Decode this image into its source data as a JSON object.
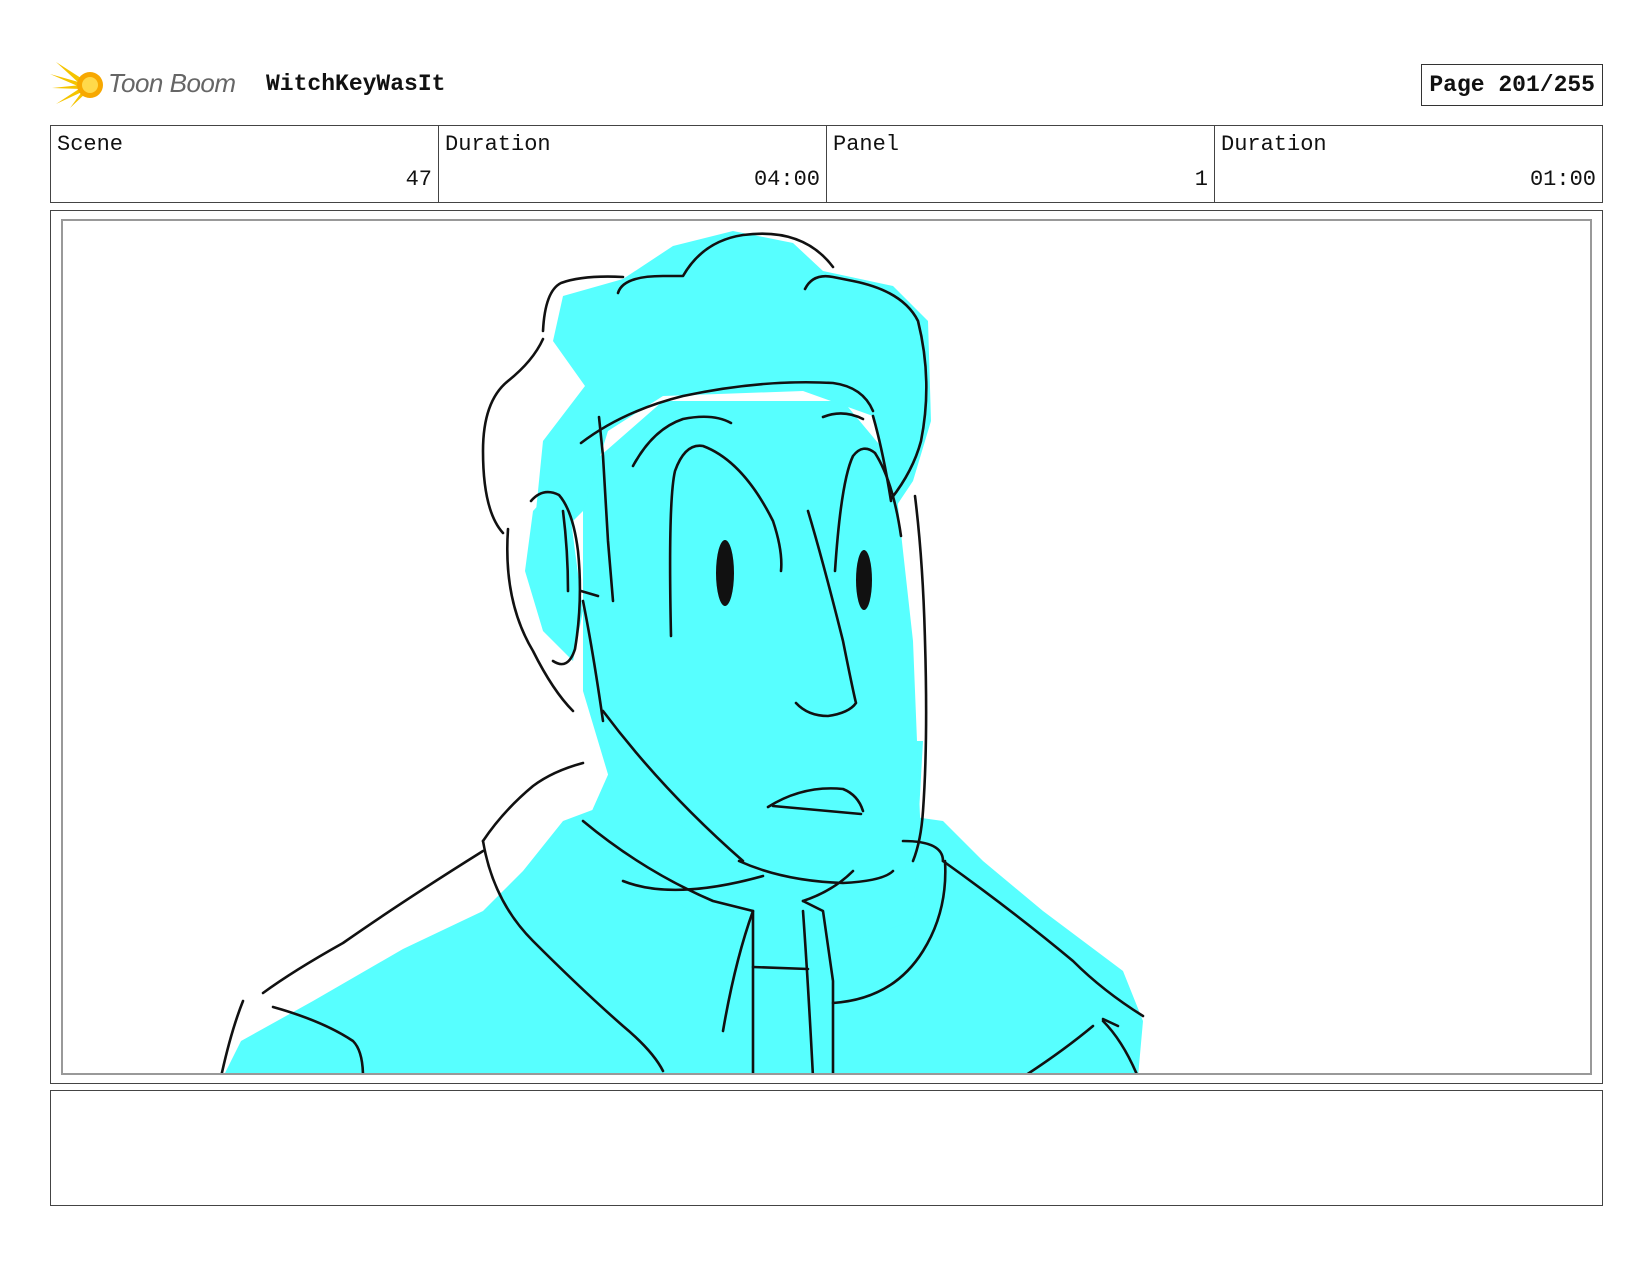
{
  "header": {
    "logo_text": "Toon Boom",
    "project_title": "WitchKeyWasIt",
    "page_label": "Page 201/255"
  },
  "info": {
    "scene_label": "Scene",
    "scene_value": "47",
    "scene_duration_label": "Duration",
    "scene_duration_value": "04:00",
    "panel_label": "Panel",
    "panel_value": "1",
    "panel_duration_label": "Duration",
    "panel_duration_value": "01:00"
  },
  "drawing": {
    "fill_color": "#57ffff",
    "line_color": "#111111"
  },
  "notes": {
    "text": ""
  }
}
